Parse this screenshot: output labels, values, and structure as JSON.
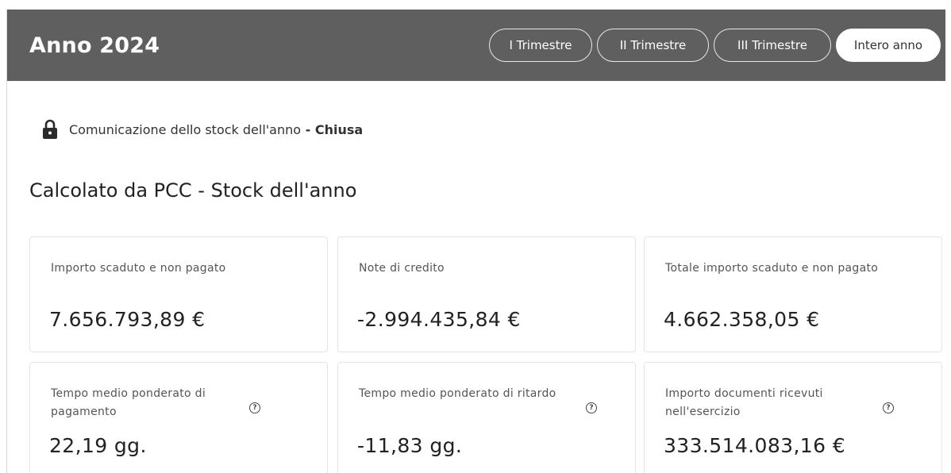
{
  "header": {
    "title": "Anno 2024",
    "tabs": [
      {
        "label": "I Trimestre",
        "active": false
      },
      {
        "label": "II Trimestre",
        "active": false
      },
      {
        "label": "III Trimestre",
        "active": false
      },
      {
        "label": "Intero anno",
        "active": true
      }
    ]
  },
  "status": {
    "icon": "lock-icon",
    "text": "Comunicazione dello stock dell'anno",
    "separator": " - ",
    "state": "Chiusa"
  },
  "section": {
    "title": "Calcolato da PCC - Stock dell'anno"
  },
  "cards": [
    {
      "label": "Importo scaduto e non pagato",
      "value": "7.656.793,89 €",
      "help": false
    },
    {
      "label": "Note di credito",
      "value": "-2.994.435,84 €",
      "help": false
    },
    {
      "label": "Totale importo scaduto e non pagato",
      "value": "4.662.358,05 €",
      "help": false
    },
    {
      "label": "Tempo medio ponderato di pagamento",
      "value": "22,19 gg.",
      "help": true
    },
    {
      "label": "Tempo medio ponderato di ritardo",
      "value": "-11,83 gg.",
      "help": true
    },
    {
      "label": "Importo documenti ricevuti nell'esercizio",
      "value": "333.514.083,16 €",
      "help": true
    }
  ],
  "help_icon": "?",
  "colors": {
    "header_bg": "#5f5f5f",
    "active_tab_bg": "#ffffff"
  }
}
